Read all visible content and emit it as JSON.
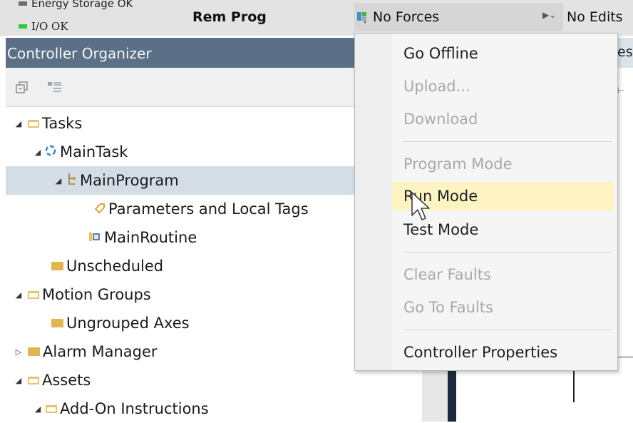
{
  "status": {
    "energy_storage": "Energy Storage OK",
    "io_status": "I/O OK",
    "mode": "Rem Prog",
    "forces": "No Forces",
    "edits": "No Edits",
    "colors": {
      "io_led": "#2ecc40",
      "energy_led": "#6b6b6b"
    }
  },
  "organizer": {
    "title": "Controller Organizer",
    "toolbar": [
      {
        "name": "collapse-all-icon"
      },
      {
        "name": "show-list-icon"
      }
    ],
    "tree": [
      {
        "label": "Tasks",
        "expanded": true
      },
      {
        "label": "MainTask",
        "expanded": true
      },
      {
        "label": "MainProgram",
        "expanded": true,
        "selected": true
      },
      {
        "label": "Parameters and Local Tags"
      },
      {
        "label": "MainRoutine"
      },
      {
        "label": "Unscheduled"
      },
      {
        "label": "Motion Groups",
        "expanded": true
      },
      {
        "label": "Ungrouped Axes"
      },
      {
        "label": "Alarm Manager",
        "expanded": false
      },
      {
        "label": "Assets",
        "expanded": true
      },
      {
        "label": "Add-On Instructions",
        "expanded": true
      }
    ]
  },
  "right_pane": {
    "tab_fragment": "es"
  },
  "menu": {
    "items": [
      {
        "label": "Go Offline",
        "enabled": true
      },
      {
        "label": "Upload...",
        "enabled": false
      },
      {
        "label": "Download",
        "enabled": false
      },
      {
        "label": "Program Mode",
        "enabled": false
      },
      {
        "label": "Run Mode",
        "enabled": true,
        "hovered": true
      },
      {
        "label": "Test Mode",
        "enabled": true
      },
      {
        "label": "Clear Faults",
        "enabled": false
      },
      {
        "label": "Go To Faults",
        "enabled": false
      },
      {
        "label": "Controller Properties",
        "enabled": true
      }
    ],
    "hover_color": "#fdf3c3"
  }
}
